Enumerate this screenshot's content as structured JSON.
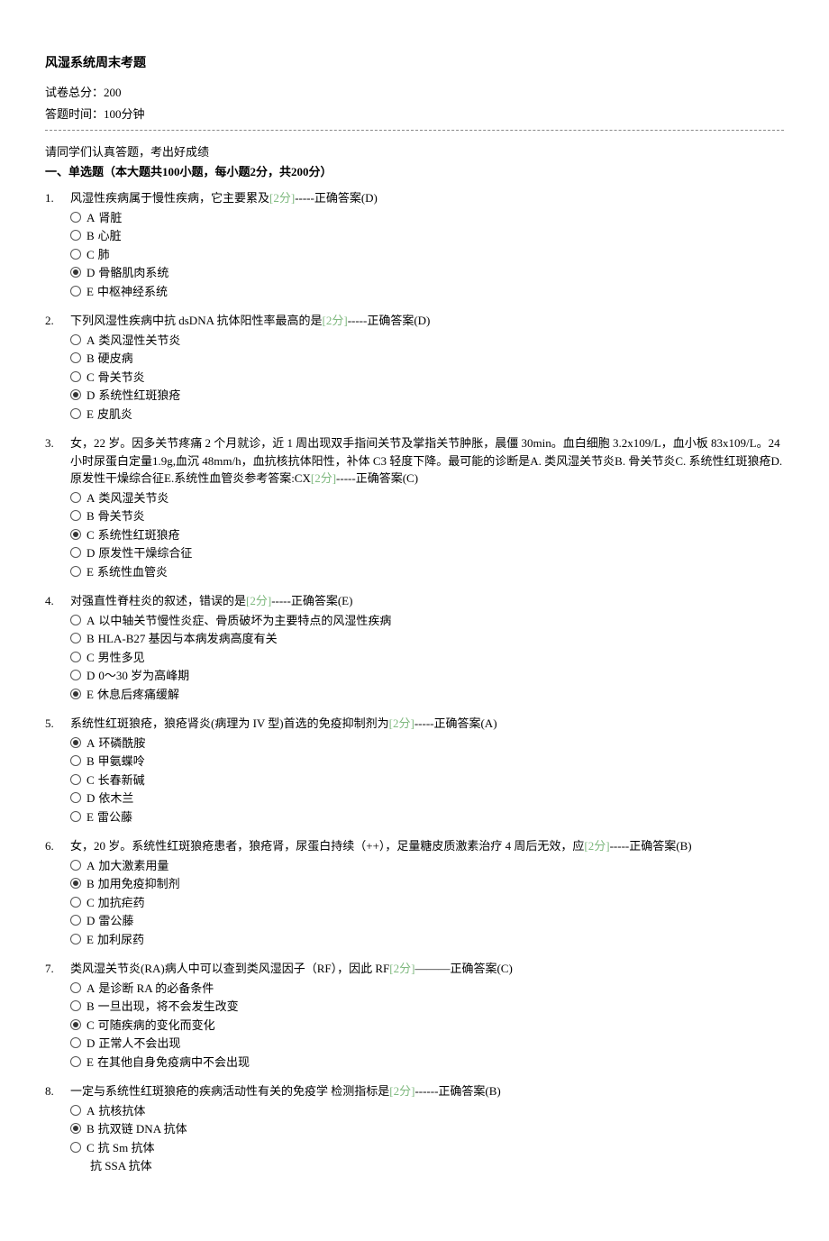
{
  "title": "风湿系统周末考题",
  "meta": {
    "total_score_label": "试卷总分：200",
    "time_label": "答题时间：100分钟"
  },
  "instructions": "请同学们认真答题，考出好成绩",
  "section_title": "一、单选题（本大题共100小题，每小题2分，共200分）",
  "questions": [
    {
      "num": "1.",
      "stem": "风湿性疾病属于慢性疾病，它主要累及",
      "score": "[2分]",
      "answer": "-----正确答案(D)",
      "options": [
        {
          "letter": "A",
          "text": "肾脏",
          "sel": false,
          "radio": true
        },
        {
          "letter": "B",
          "text": "心脏",
          "sel": false,
          "radio": true
        },
        {
          "letter": "C",
          "text": "肺",
          "sel": false,
          "radio": true
        },
        {
          "letter": "D",
          "text": "骨骼肌肉系统",
          "sel": true,
          "radio": true
        },
        {
          "letter": "E",
          "text": "中枢神经系统",
          "sel": false,
          "radio": true
        }
      ]
    },
    {
      "num": "2.",
      "stem": "下列风湿性疾病中抗 dsDNA 抗体阳性率最高的是",
      "score": "[2分]",
      "answer": "-----正确答案(D)",
      "options": [
        {
          "letter": "A",
          "text": "类风湿性关节炎",
          "sel": false,
          "radio": true
        },
        {
          "letter": "B",
          "text": "硬皮病",
          "sel": false,
          "radio": true
        },
        {
          "letter": "C",
          "text": "骨关节炎",
          "sel": false,
          "radio": true
        },
        {
          "letter": "D",
          "text": "系统性红斑狼疮",
          "sel": true,
          "radio": true
        },
        {
          "letter": "E",
          "text": "  皮肌炎",
          "sel": false,
          "radio": true
        }
      ]
    },
    {
      "num": "3.",
      "stem": "女，22 岁。因多关节疼痛 2 个月就诊，近 1 周出现双手指间关节及掌指关节肿胀，晨僵 30min。血白细胞 3.2x109/L，血小板 83x109/L。24 小时尿蛋白定量1.9g,血沉 48mm/h，血抗核抗体阳性，补体 C3 轻度下降。最可能的诊断是A. 类风湿关节炎B. 骨关节炎C. 系统性红斑狼疮D. 原发性干燥综合征E.系统性血管炎参考答案:CX",
      "score": "[2分]",
      "answer": "-----正确答案(C)",
      "options": [
        {
          "letter": "A",
          "text": "类风湿关节炎",
          "sel": false,
          "radio": true
        },
        {
          "letter": "B",
          "text": "骨关节炎",
          "sel": false,
          "radio": true
        },
        {
          "letter": "C",
          "text": "系统性红斑狼疮",
          "sel": true,
          "radio": true
        },
        {
          "letter": "D",
          "text": "原发性干燥综合征",
          "sel": false,
          "radio": true
        },
        {
          "letter": "E",
          "text": "系统性血管炎",
          "sel": false,
          "radio": true
        }
      ]
    },
    {
      "num": "4.",
      "stem": "对强直性脊柱炎的叙述，错误的是",
      "score": "[2分]",
      "answer": "-----正确答案(E)",
      "options": [
        {
          "letter": "A",
          "text": "以中轴关节慢性炎症、骨质破坏为主要特点的风湿性疾病",
          "sel": false,
          "radio": true
        },
        {
          "letter": "B",
          "text": "HLA-B27 基因与本病发病高度有关",
          "sel": false,
          "radio": true
        },
        {
          "letter": "C",
          "text": "  男性多见",
          "sel": false,
          "radio": true
        },
        {
          "letter": "D",
          "text": "  0～30 岁为高峰期",
          "sel": false,
          "radio": true
        },
        {
          "letter": "E",
          "text": "休息后疼痛缓解",
          "sel": true,
          "radio": true
        }
      ]
    },
    {
      "num": "5.",
      "stem": "系统性红斑狼疮，狼疮肾炎(病理为 IV 型)首选的免疫抑制剂为",
      "score": "[2分]",
      "answer": "-----正确答案(A)",
      "options": [
        {
          "letter": "A",
          "text": "  环磷酰胺",
          "sel": true,
          "radio": true
        },
        {
          "letter": "B",
          "text": "甲氨蝶呤",
          "sel": false,
          "radio": true
        },
        {
          "letter": "C",
          "text": "长春新碱",
          "sel": false,
          "radio": true
        },
        {
          "letter": "D",
          "text": "依木兰",
          "sel": false,
          "radio": true
        },
        {
          "letter": "E",
          "text": "雷公藤",
          "sel": false,
          "radio": true
        }
      ]
    },
    {
      "num": "6.",
      "stem": " 女，20 岁。系统性红斑狼疮患者，狼疮肾，尿蛋白持续（++），足量糖皮质激素治疗 4 周后无效，应",
      "score": "[2分]",
      "answer": "-----正确答案(B)",
      "options": [
        {
          "letter": "A",
          "text": "加大激素用量",
          "sel": false,
          "radio": true
        },
        {
          "letter": "B",
          "text": "加用免疫抑制剂",
          "sel": true,
          "radio": true
        },
        {
          "letter": "C",
          "text": "加抗疟药",
          "sel": false,
          "radio": true
        },
        {
          "letter": "D",
          "text": "雷公藤",
          "sel": false,
          "radio": true
        },
        {
          "letter": "E",
          "text": "加利尿药",
          "sel": false,
          "radio": true
        }
      ]
    },
    {
      "num": "7.",
      "stem": " 类风湿关节炎(RA)病人中可以查到类风湿因子（RF），因此 RF",
      "score": "[2分]",
      "answer": "———正确答案(C)",
      "options": [
        {
          "letter": "A",
          "text": "是诊断 RA 的必备条件",
          "sel": false,
          "radio": true
        },
        {
          "letter": "B",
          "text": "一旦出现，将不会发生改变",
          "sel": false,
          "radio": true
        },
        {
          "letter": "C",
          "text": "可随疾病的变化而变化",
          "sel": true,
          "radio": true
        },
        {
          "letter": "D",
          "text": "正常人不会出现",
          "sel": false,
          "radio": true
        },
        {
          "letter": "E",
          "text": "在其他自身免疫病中不会出现",
          "sel": false,
          "radio": true
        }
      ]
    },
    {
      "num": "8.",
      "stem": "一定与系统性红斑狼疮的疾病活动性有关的免疫学 检测指标是",
      "score": "[2分]",
      "answer": "------正确答案(B)",
      "options": [
        {
          "letter": "A",
          "text": "抗核抗体",
          "sel": false,
          "radio": true
        },
        {
          "letter": "B",
          "text": "  抗双链 DNA 抗体",
          "sel": true,
          "radio": true
        },
        {
          "letter": "C",
          "text": "抗 Sm 抗体",
          "sel": false,
          "radio": true
        },
        {
          "letter": "",
          "text": "  抗 SSA 抗体",
          "sel": false,
          "radio": false
        }
      ]
    }
  ]
}
